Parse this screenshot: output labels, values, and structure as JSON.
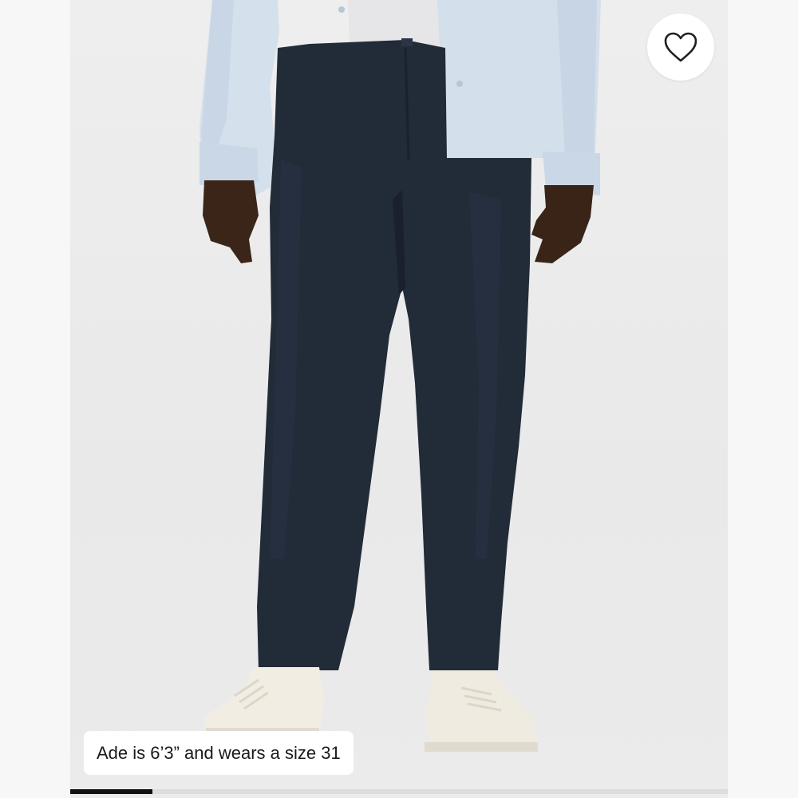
{
  "product_image": {
    "caption": "Ade is 6’3” and wears a size 31",
    "favorite_icon": "heart-outline-icon",
    "gallery_progress": 0.125
  },
  "colors": {
    "shirt": "#d3dfec",
    "pants": "#222b38",
    "shoes": "#f1ece2",
    "skin": "#3a2419",
    "backdrop": "#ececec"
  }
}
